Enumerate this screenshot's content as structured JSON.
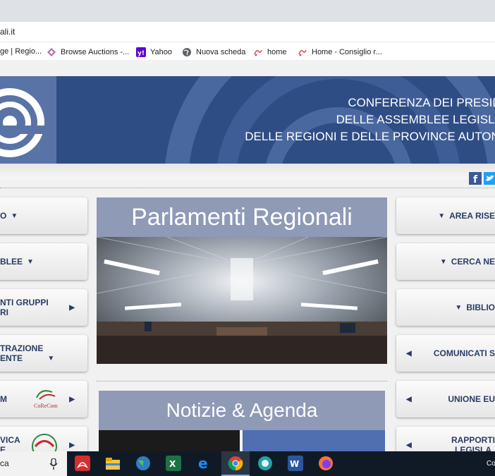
{
  "browser": {
    "url": "ali.it",
    "bookmarks": [
      {
        "label": "ge | Regio...",
        "icon": "page-icon"
      },
      {
        "label": "Browse Auctions -...",
        "icon": "diamond-icon"
      },
      {
        "label": "Yahoo",
        "icon": "yahoo-icon"
      },
      {
        "label": "Nuova scheda",
        "icon": "globe-icon"
      },
      {
        "label": "home",
        "icon": "site-icon"
      },
      {
        "label": "Home - Consiglio r...",
        "icon": "site-icon"
      }
    ]
  },
  "banner": {
    "line1": "CONFERENZA DEI PRESIDE",
    "line2": "DELLE ASSEMBLEE LEGISLAT",
    "line3": "DELLE REGIONI E DELLE PROVINCE AUTONO"
  },
  "left_menu": [
    {
      "label": "O"
    },
    {
      "label": "BLEE"
    },
    {
      "label": "NTI GRUPPI\nRI"
    },
    {
      "label": "TRAZIONE\nENTE"
    },
    {
      "label": "M"
    },
    {
      "label": "VICA\nE"
    }
  ],
  "right_menu": [
    {
      "label": "AREA RISE"
    },
    {
      "label": "CERCA NE"
    },
    {
      "label": "BIBLIO"
    },
    {
      "label": "COMUNICATI S"
    },
    {
      "label": "UNIONE EU"
    },
    {
      "label": "RAPPORTI\nLEGISLA"
    }
  ],
  "corecom_logo": "CoReCom",
  "main": {
    "section1_title": "Parlamenti Regionali",
    "section2_title": "Notizie & Agenda"
  },
  "taskbar": {
    "search_text": "ca",
    "tray_text": "Co"
  }
}
